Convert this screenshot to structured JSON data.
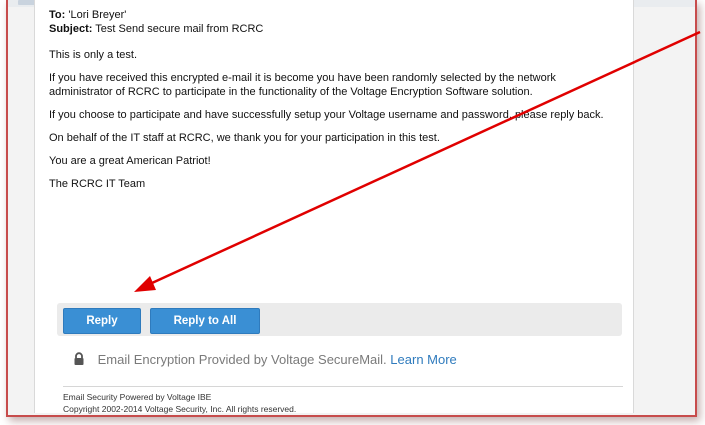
{
  "email": {
    "to_label": "To:",
    "to_value": "'Lori Breyer'",
    "subject_label": "Subject:",
    "subject_value": "Test Send secure mail from RCRC",
    "body": [
      "This is only a test.",
      "If you have received this encrypted e-mail it is become you have been randomly selected by the network administrator of RCRC to participate in the functionality of the Voltage Encryption Software solution.",
      "If you choose to participate and have successfully setup your Voltage username and password, please reply back.",
      "On behalf of the IT staff at RCRC, we thank you for your participation in this test.",
      "You are a great American Patriot!",
      "The RCRC IT Team"
    ]
  },
  "actions": {
    "reply_label": "Reply",
    "reply_all_label": "Reply to All"
  },
  "encryption": {
    "icon": "lock-icon",
    "text": "Email Encryption Provided by Voltage SecureMail.",
    "learn_more": "Learn More"
  },
  "footer": {
    "line1": "Email Security Powered by Voltage IBE",
    "line2": "Copyright 2002-2014 Voltage Security, Inc. All rights reserved."
  },
  "colors": {
    "button": "#3a8fd4",
    "link": "#2f7bbd",
    "annotation_arrow": "#e00000",
    "frame_border": "#c74c4c"
  }
}
